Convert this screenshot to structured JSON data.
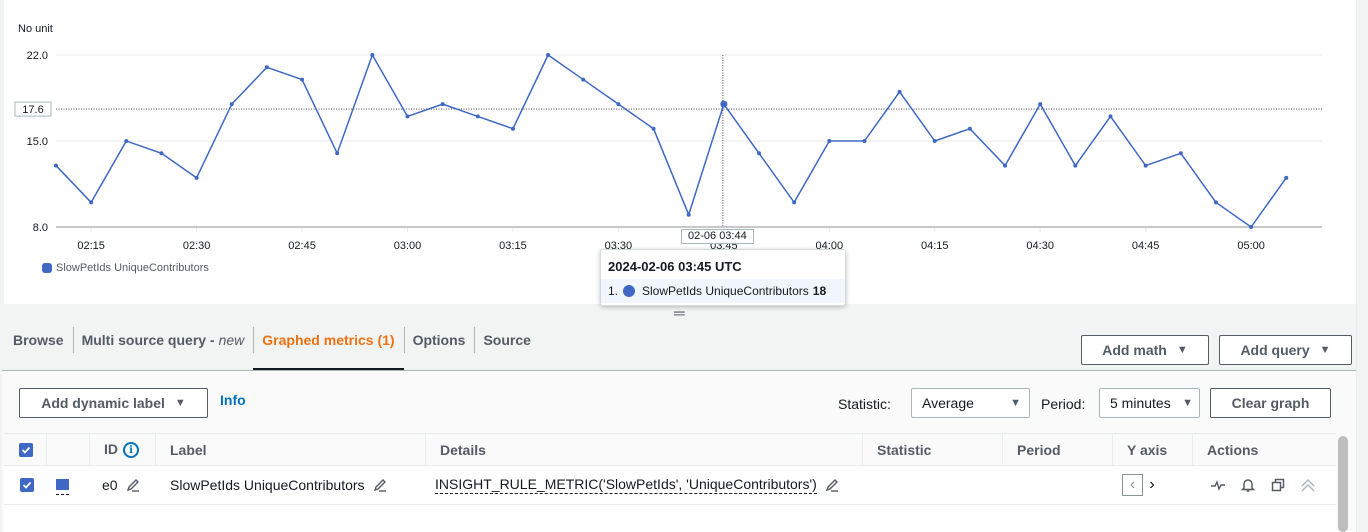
{
  "chart_data": {
    "type": "line",
    "title": "",
    "ylabel": "No unit",
    "xlabel": "",
    "ylim": [
      8.0,
      22.0
    ],
    "yticks": [
      "8.0",
      "15.0",
      "22.0"
    ],
    "grid": true,
    "legend_position": "bottom-left",
    "x": [
      "02:10",
      "02:15",
      "02:20",
      "02:25",
      "02:30",
      "02:35",
      "02:40",
      "02:45",
      "02:50",
      "02:55",
      "03:00",
      "03:05",
      "03:10",
      "03:15",
      "03:20",
      "03:25",
      "03:30",
      "03:35",
      "03:40",
      "03:45",
      "03:50",
      "03:55",
      "04:00",
      "04:05",
      "04:10",
      "04:15",
      "04:20",
      "04:25",
      "04:30",
      "04:35",
      "04:40",
      "04:45",
      "04:50",
      "04:55",
      "05:00",
      "05:05"
    ],
    "xticks": [
      "02:15",
      "02:30",
      "02:45",
      "03:00",
      "03:15",
      "03:30",
      "03:45",
      "04:00",
      "04:15",
      "04:30",
      "04:45",
      "05:00"
    ],
    "series": [
      {
        "name": "SlowPetIds UniqueContributors",
        "color": "#3f68c5",
        "values": [
          13,
          10,
          15,
          14,
          12,
          18,
          21,
          20,
          14,
          22,
          17,
          18,
          17,
          16,
          22,
          20,
          18,
          16,
          9,
          18,
          14,
          10,
          15,
          15,
          19,
          15,
          16,
          13,
          18,
          13,
          17,
          13,
          14,
          10,
          8,
          12
        ]
      }
    ],
    "crosshair": {
      "x": "03:45",
      "y_label": "17.6",
      "x_label": "02-06 03:44",
      "highlight_index": 19
    }
  },
  "tooltip": {
    "title": "2024-02-06 03:45 UTC",
    "rows": [
      {
        "index": "1.",
        "name": "SlowPetIds UniqueContributors",
        "value": "18",
        "color": "#3f68c5"
      }
    ]
  },
  "tabs": [
    {
      "label": "Browse",
      "suffix": ""
    },
    {
      "label": "Multi source query -",
      "suffix": "new"
    },
    {
      "label": "Graphed metrics (1)",
      "suffix": "",
      "active": true
    },
    {
      "label": "Options",
      "suffix": ""
    },
    {
      "label": "Source",
      "suffix": ""
    }
  ],
  "toolbar": {
    "add_math": "Add math",
    "add_query": "Add query",
    "add_dynamic_label": "Add dynamic label",
    "info": "Info",
    "statistic_label": "Statistic:",
    "statistic_value": "Average",
    "period_label": "Period:",
    "period_value": "5 minutes",
    "clear_graph": "Clear graph"
  },
  "table": {
    "columns": [
      "",
      "",
      "ID",
      "Label",
      "Details",
      "Statistic",
      "Period",
      "Y axis",
      "Actions"
    ],
    "rows": [
      {
        "checked": true,
        "color": "#3f68c5",
        "id": "e0",
        "label": "SlowPetIds UniqueContributors",
        "details": "INSIGHT_RULE_METRIC('SlowPetIds', 'UniqueContributors')",
        "statistic": "",
        "period": "",
        "y_axis": "left"
      }
    ]
  },
  "icons": {
    "checkbox": "checkmark-icon",
    "edit": "pencil-icon",
    "info": "info-circle-icon",
    "actions": [
      "graph-icon",
      "bell-alarm-icon",
      "duplicate-icon",
      "chevron-double-up-icon"
    ]
  }
}
